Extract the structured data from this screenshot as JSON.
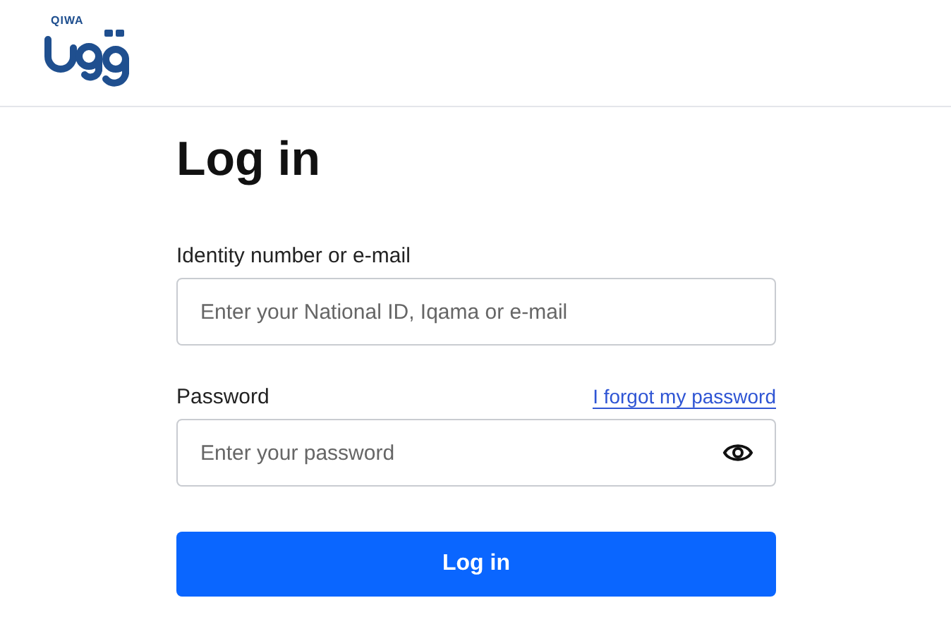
{
  "header": {
    "logo_text": "QIWA"
  },
  "title": "Log in",
  "fields": [
    {
      "label": "Identity number or e-mail",
      "placeholder": "Enter your National ID, Iqama or e-mail",
      "kind": "text"
    },
    {
      "label": "Password",
      "placeholder": "Enter your password",
      "kind": "password",
      "link": "I forgot my password"
    }
  ],
  "submit": "Log in"
}
